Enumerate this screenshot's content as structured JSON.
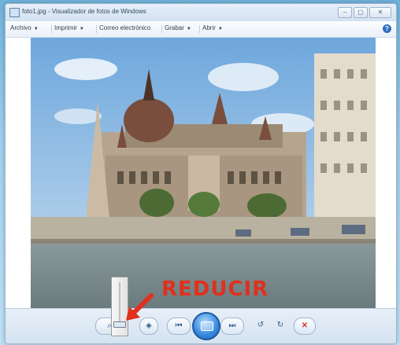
{
  "window": {
    "title": "foto1.jpg - Visualizador de fotos de Windows"
  },
  "menu": [
    {
      "label": "Archivo",
      "has_dropdown": true
    },
    {
      "label": "Imprimir",
      "has_dropdown": true
    },
    {
      "label": "Correo electrónico",
      "has_dropdown": false
    },
    {
      "label": "Grabar",
      "has_dropdown": true
    },
    {
      "label": "Abrir",
      "has_dropdown": true
    }
  ],
  "help_icon": "?",
  "annotation": {
    "text": "REDUCIR",
    "color": "#e0301e"
  },
  "toolbar": {
    "zoom_icon": "magnifier-icon",
    "fit_icon": "fit-window-icon",
    "prev_icon": "previous-icon",
    "slideshow_icon": "slideshow-icon",
    "next_icon": "next-icon",
    "rotate_ccw_icon": "rotate-counterclockwise-icon",
    "rotate_cw_icon": "rotate-clockwise-icon",
    "delete_icon": "delete-icon"
  },
  "colors": {
    "accent": "#2f6fc0",
    "delete": "#d8352a"
  }
}
